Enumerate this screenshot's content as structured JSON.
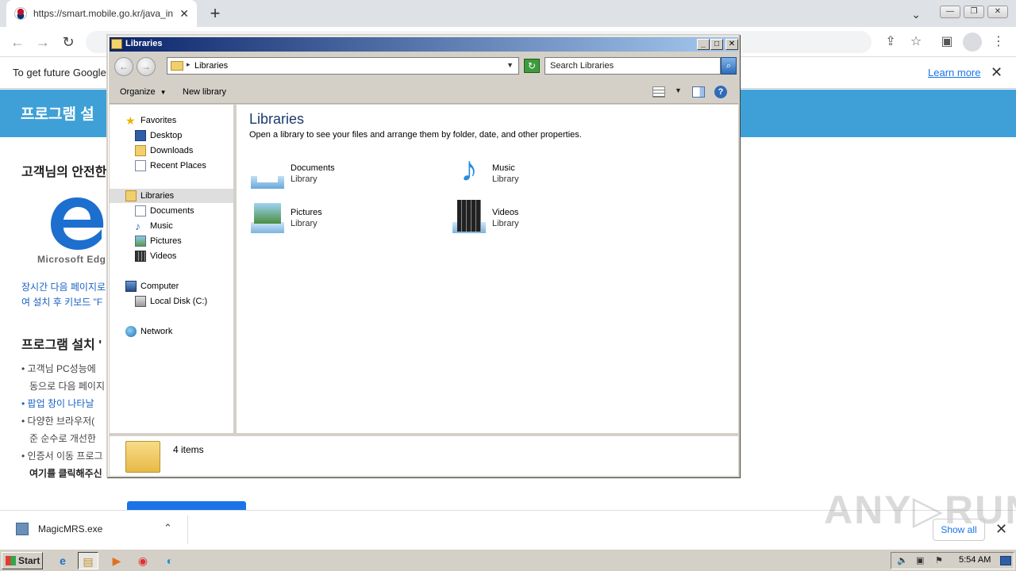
{
  "browser": {
    "tab_title": "https://smart.mobile.go.kr/java_inst",
    "tab_close": "✕",
    "new_tab": "+",
    "window_chevron": "⌄",
    "win_buttons": [
      "—",
      "❐",
      "✕"
    ],
    "nav_icons": [
      "←",
      "→",
      "↻"
    ],
    "toolbar_icons": [
      "⇪",
      "☆",
      "▣",
      "⋮"
    ],
    "infobar_message": "To get future Google",
    "infobar_link": "Learn more",
    "infobar_close": "✕"
  },
  "page": {
    "banner_title": "프로그램 설",
    "heading1": "고객님의 안전한",
    "edge_caption": "Microsoft Edg",
    "link_line1": "장시간 다음 페이지로",
    "link_line2": "여 설치 후 키보드 \"F",
    "heading2": "프로그램 설치 '",
    "bullets": [
      "• 고객님 PC성능에",
      "동으로 다음 페이지",
      "• 팝업 창이 나타날",
      "• 다양한 브라우저(",
      "준 순수로 개선한",
      "• 인증서 이동 프로그",
      "여기를 클릭해주신"
    ]
  },
  "download_shelf": {
    "file_name": "MagicMRS.exe",
    "arrow": "⌃",
    "show_all": "Show all",
    "close": "✕",
    "watermark": "ANY▷RUN"
  },
  "taskbar": {
    "start_label": "Start",
    "apps": [
      "e",
      "▤",
      "▶",
      "◉",
      "◐"
    ],
    "tray_icons": [
      "🔈",
      "▣",
      "⚑"
    ],
    "clock": "5:54 AM"
  },
  "explorer": {
    "window_title": "Libraries",
    "caption_buttons": [
      "_",
      "□",
      "✕"
    ],
    "back_arrow": "←",
    "forward_arrow": "→",
    "address_sep": "▸",
    "address": "Libraries",
    "address_dropdown": "▼",
    "refresh_icon": "↻",
    "search_placeholder": "Search Libraries",
    "search_icon": "⌕",
    "organize": "Organize",
    "new_library": "New library",
    "dropdown_arrow": "▼",
    "help": "?",
    "nav": {
      "favorites": "Favorites",
      "desktop": "Desktop",
      "downloads": "Downloads",
      "recent_places": "Recent Places",
      "libraries": "Libraries",
      "documents": "Documents",
      "music": "Music",
      "pictures": "Pictures",
      "videos": "Videos",
      "computer": "Computer",
      "local_disk": "Local Disk (C:)",
      "network": "Network"
    },
    "content_title": "Libraries",
    "content_subtitle": "Open a library to see your files and arrange them by folder, date, and other properties.",
    "libraries": [
      {
        "name": "Documents",
        "kind": "Library"
      },
      {
        "name": "Music",
        "kind": "Library"
      },
      {
        "name": "Pictures",
        "kind": "Library"
      },
      {
        "name": "Videos",
        "kind": "Library"
      }
    ],
    "item_count": "4 items"
  }
}
